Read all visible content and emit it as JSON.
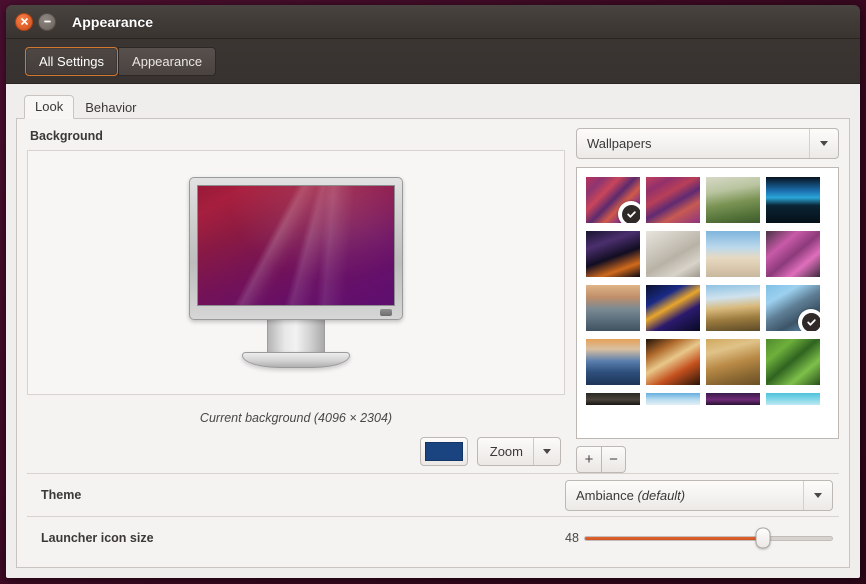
{
  "window": {
    "title": "Appearance",
    "close_icon": "close-icon",
    "minimize_icon": "minimize-icon"
  },
  "toolbar": {
    "buttons": [
      {
        "label": "All Settings",
        "active": true
      },
      {
        "label": "Appearance",
        "active": false
      }
    ]
  },
  "tabs": [
    {
      "label": "Look",
      "active": true
    },
    {
      "label": "Behavior",
      "active": false
    }
  ],
  "background_section": {
    "title": "Background",
    "caption": "Current background (4096 × 2304)",
    "color_swatch": "#1a4480",
    "color_swatch_name": "background-color-swatch",
    "zoom_button": {
      "label": "Zoom",
      "arrow_icon": "chevron-down-icon"
    }
  },
  "wallpapers": {
    "source_label": "Wallpapers",
    "source_arrow_icon": "chevron-down-icon",
    "add_label": "+",
    "remove_label": "−",
    "items": [
      {
        "name": "abstract-pink-paint",
        "selected": true,
        "css": "linear-gradient(135deg,#b7345c 0%,#8e3570 18%,#c9455a 34%,#5c2a6e 50%,#d05a4a 64%,#7b2f86 80%,#b4356a 100%)"
      },
      {
        "name": "abstract-pink-paint-2",
        "selected": false,
        "css": "linear-gradient(150deg,#c0405e 0%,#93306b 20%,#b83f58 38%,#5f2a73 55%,#c75a52 72%,#8e3380 100%)"
      },
      {
        "name": "bird-on-green-stem",
        "selected": false,
        "css": "linear-gradient(170deg,#d5d9c6 0%,#b9c49f 30%,#7b9455 55%,#55743a 80%,#3d5a2c 100%)"
      },
      {
        "name": "blue-night-lights",
        "selected": false,
        "css": "linear-gradient(180deg,#071320 0%,#1b6fae 30%,#2aa6d8 45%,#0a2434 62%,#051018 100%)"
      },
      {
        "name": "concert-crowd-silhouette",
        "selected": false,
        "css": "linear-gradient(160deg,#1a1430 0%,#4b2f6e 28%,#120d22 55%,#d06a1c 78%,#0b0814 100%)"
      },
      {
        "name": "pebble-beach-stones",
        "selected": false,
        "css": "linear-gradient(150deg,#e7e4dd 0%,#cfcac0 30%,#b8b2a6 55%,#d8d3c9 78%,#9e978b 100%)"
      },
      {
        "name": "beach-horizon-people",
        "selected": false,
        "css": "linear-gradient(180deg,#7fb5dd 0%,#bcd9ec 36%,#e6d9c2 58%,#d9c8ae 80%,#c7b79d 100%)"
      },
      {
        "name": "pink-wildflowers",
        "selected": false,
        "css": "linear-gradient(140deg,#4a3246 0%,#c85aa8 30%,#8c3a7a 52%,#e06fbc 72%,#3c2a3d 100%)"
      },
      {
        "name": "coastal-sunset-rocks",
        "selected": false,
        "css": "linear-gradient(180deg,#e0b487 0%,#c08f6a 26%,#7b8a93 52%,#5e717e 74%,#3f5160 100%)"
      },
      {
        "name": "blue-macro-abstract",
        "selected": false,
        "css": "linear-gradient(150deg,#0a1230 0%,#1a2a86 28%,#e8a62c 46%,#2b1a6e 66%,#070a22 100%)"
      },
      {
        "name": "wheat-field-sunrise",
        "selected": false,
        "css": "linear-gradient(175deg,#8ec3e2 0%,#cfe2ee 28%,#d8b87a 50%,#9c7b3e 72%,#5c4a28 100%)"
      },
      {
        "name": "blue-metal-structure",
        "selected": true,
        "css": "linear-gradient(150deg,#7fc0e6 0%,#9cd0ef 25%,#5f7f96 48%,#3c5468 70%,#6fa8cc 100%)"
      },
      {
        "name": "cairn-sunset-water",
        "selected": false,
        "css": "linear-gradient(180deg,#e5a25a 0%,#d9c0a0 22%,#5a7fae 48%,#2e4f7c 72%,#1d3557 100%)"
      },
      {
        "name": "sea-anemone-closeup",
        "selected": false,
        "css": "linear-gradient(150deg,#20130a 0%,#b06a2c 25%,#e8c78a 45%,#c4501e 68%,#2a1508 100%)"
      },
      {
        "name": "golden-grass-bokeh",
        "selected": false,
        "css": "linear-gradient(165deg,#cfa85e 0%,#e0c389 25%,#b98a46 52%,#8e6a33 76%,#6a4f26 100%)"
      },
      {
        "name": "green-clover-leaves",
        "selected": false,
        "css": "linear-gradient(140deg,#4f8a2e 0%,#6fb03c 25%,#2f6320 48%,#7ec04a 72%,#27501a 100%)"
      },
      {
        "name": "dark-gradient-strip",
        "selected": false,
        "css": "linear-gradient(180deg,#2b2723 0%,#4a433c 55%,#1a1613 100%)"
      },
      {
        "name": "mountain-sky-strip",
        "selected": false,
        "css": "linear-gradient(180deg,#66aede 0%,#b9dcf0 55%,#e2eef6 100%)"
      },
      {
        "name": "purple-texture-strip",
        "selected": false,
        "css": "linear-gradient(180deg,#3a1b4a 0%,#6f2c78 55%,#2a1234 100%)"
      },
      {
        "name": "cyan-sky-strip",
        "selected": false,
        "css": "linear-gradient(180deg,#4fc2dd 0%,#86d9e9 55%,#bfe9f2 100%)"
      }
    ]
  },
  "theme_row": {
    "label": "Theme",
    "value": "Ambiance",
    "value_note": "(default)",
    "arrow_icon": "chevron-down-icon"
  },
  "launcher_row": {
    "label": "Launcher icon size",
    "value": "48",
    "fill_percent": 72
  }
}
